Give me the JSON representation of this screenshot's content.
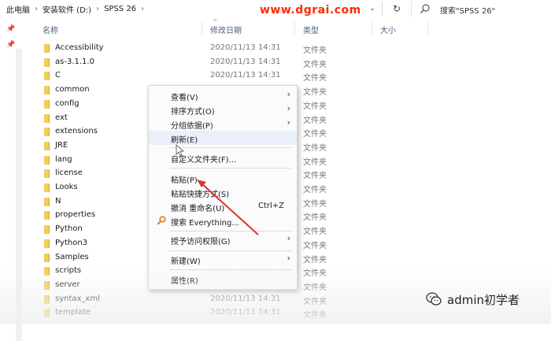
{
  "breadcrumbs": [
    "此电脑",
    "安装软件 (D:)",
    "SPSS 26"
  ],
  "watermark_site": "www.dgrai.com",
  "search": {
    "placeholder": "搜索\"SPSS 26\""
  },
  "columns": {
    "name": "名称",
    "date": "修改日期",
    "type": "类型",
    "size": "大小"
  },
  "files": [
    {
      "name": "Accessibility",
      "date": "2020/11/13 14:31",
      "type": "文件夹"
    },
    {
      "name": "as-3.1.1.0",
      "date": "2020/11/13 14:31",
      "type": "文件夹"
    },
    {
      "name": "C",
      "date": "2020/11/13 14:31",
      "type": "文件夹"
    },
    {
      "name": "common",
      "date": "",
      "type": "文件夹"
    },
    {
      "name": "config",
      "date": "",
      "type": "文件夹"
    },
    {
      "name": "ext",
      "date": "",
      "type": "文件夹"
    },
    {
      "name": "extensions",
      "date": "",
      "type": "文件夹"
    },
    {
      "name": "JRE",
      "date": "",
      "type": "文件夹"
    },
    {
      "name": "lang",
      "date": "",
      "type": "文件夹"
    },
    {
      "name": "license",
      "date": "",
      "type": "文件夹"
    },
    {
      "name": "Looks",
      "date": "",
      "type": "文件夹"
    },
    {
      "name": "N",
      "date": "",
      "type": "文件夹"
    },
    {
      "name": "properties",
      "date": "",
      "type": "文件夹"
    },
    {
      "name": "Python",
      "date": "",
      "type": "文件夹"
    },
    {
      "name": "Python3",
      "date": "",
      "type": "文件夹"
    },
    {
      "name": "Samples",
      "date": "",
      "type": "文件夹"
    },
    {
      "name": "scripts",
      "date": "",
      "type": "文件夹"
    },
    {
      "name": "server",
      "date": "2020/11/13 14:31",
      "type": "文件夹"
    },
    {
      "name": "syntax_xml",
      "date": "2020/11/13 14:31",
      "type": "文件夹"
    },
    {
      "name": "template",
      "date": "2020/11/13 14:31",
      "type": "文件夹"
    }
  ],
  "context_menu": {
    "view": "查看(V)",
    "sort": "排序方式(O)",
    "group": "分组依据(P)",
    "refresh": "刷新(E)",
    "customize": "自定义文件夹(F)...",
    "paste": "粘贴(P)",
    "paste_shortcut": "粘贴快捷方式(S)",
    "undo": "撤消 重命名(U)",
    "undo_accel": "Ctrl+Z",
    "everything": "搜索 Everything...",
    "access": "授予访问权限(G)",
    "new": "新建(W)",
    "properties": "属性(R)"
  },
  "wechat_account": "admin初学者",
  "colors": {
    "folder": "#f3cd58",
    "arrow": "#d9342b",
    "header_text": "#4c607a"
  }
}
